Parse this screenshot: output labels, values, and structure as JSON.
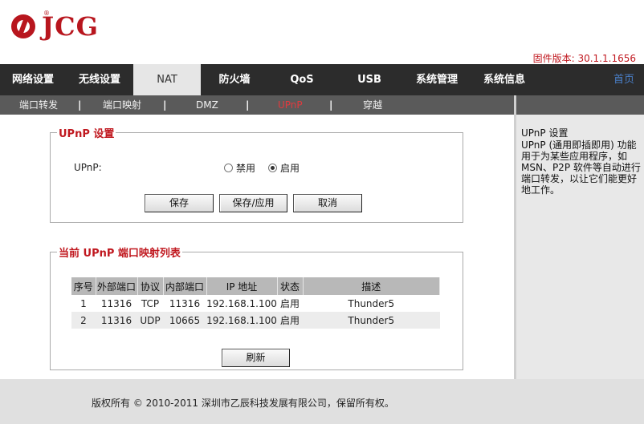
{
  "header": {
    "brand": "JCG",
    "firmware": "固件版本: 30.1.1.1656"
  },
  "nav": {
    "items": [
      "网络设置",
      "无线设置",
      "NAT",
      "防火墙",
      "QoS",
      "USB",
      "系统管理",
      "系统信息"
    ],
    "active": "NAT",
    "home": "首页"
  },
  "subnav": {
    "items": [
      "端口转发",
      "端口映射",
      "DMZ",
      "UPnP",
      "穿越"
    ],
    "active": "UPnP"
  },
  "upnp_settings": {
    "title": "UPnP 设置",
    "label": "UPnP:",
    "options": [
      "禁用",
      "启用"
    ],
    "selected": "启用",
    "buttons": {
      "save": "保存",
      "save_apply": "保存/应用",
      "cancel": "取消"
    }
  },
  "mapping": {
    "title": "当前 UPnP 端口映射列表",
    "columns": [
      "序号",
      "外部端口",
      "协议",
      "内部端口",
      "IP 地址",
      "状态",
      "描述"
    ],
    "rows": [
      [
        "1",
        "11316",
        "TCP",
        "11316",
        "192.168.1.100",
        "启用",
        "Thunder5"
      ],
      [
        "2",
        "11316",
        "UDP",
        "10665",
        "192.168.1.100",
        "启用",
        "Thunder5"
      ]
    ],
    "refresh": "刷新"
  },
  "help": {
    "title": "UPnP 设置",
    "text": "UPnP (通用即插即用) 功能用于为某些应用程序，如 MSN、P2P 软件等自动进行端口转发，以让它们能更好地工作。"
  },
  "footer": {
    "copyright": "版权所有 © 2010-2011 深圳市乙辰科技发展有限公司，保留所有权。"
  },
  "colors": {
    "brand_red": "#b8161e",
    "nav_bg": "#2c2c2c",
    "subnav_bg": "#5a5a5a",
    "legend_red": "#c0181f"
  }
}
